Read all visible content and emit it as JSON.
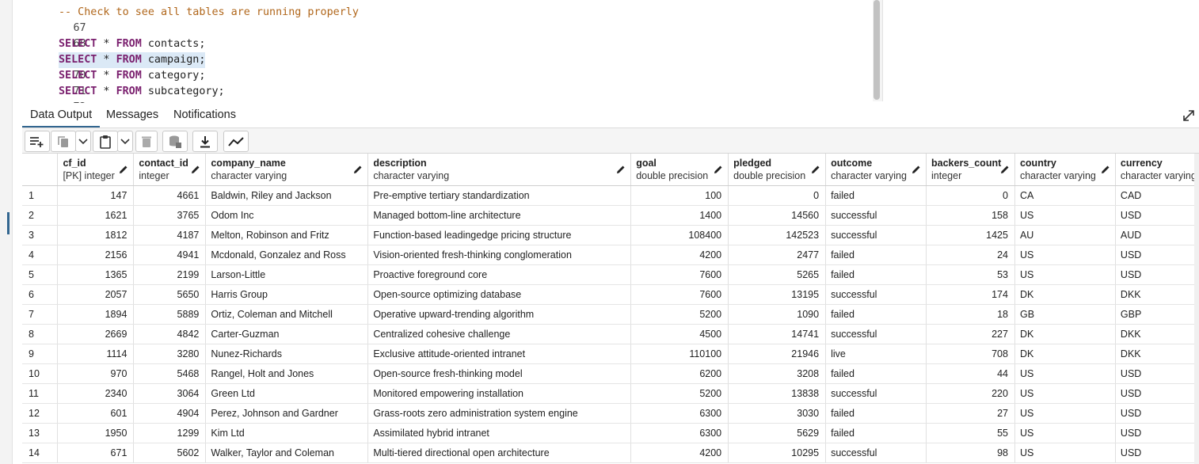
{
  "editor": {
    "lines": [
      {
        "num": "67",
        "comment": "-- Check to see all tables are running properly"
      },
      {
        "num": "68"
      },
      {
        "num": "69",
        "kw1": "SELECT",
        "op": " * ",
        "kw2": "FROM",
        "rest": " contacts;"
      },
      {
        "num": "70",
        "kw1": "SELECT",
        "op": " * ",
        "kw2": "FROM",
        "rest": " campaign;"
      },
      {
        "num": "71",
        "kw1": "SELECT",
        "op": " * ",
        "kw2": "FROM",
        "rest": " category;"
      },
      {
        "num": "72",
        "kw1": "SELECT",
        "op": " * ",
        "kw2": "FROM",
        "rest": " subcategory;"
      }
    ]
  },
  "tabs": {
    "data_output": "Data Output",
    "messages": "Messages",
    "notifications": "Notifications"
  },
  "toolbar": {
    "icons": [
      "add-row-icon",
      "copy-icon",
      "chevron-down-icon",
      "paste-icon",
      "chevron-down-icon",
      "delete-icon",
      "save-data-icon",
      "download-icon",
      "graph-icon"
    ]
  },
  "grid": {
    "columns": [
      {
        "name": "cf_id",
        "type": "[PK] integer"
      },
      {
        "name": "contact_id",
        "type": "integer"
      },
      {
        "name": "company_name",
        "type": "character varying"
      },
      {
        "name": "description",
        "type": "character varying"
      },
      {
        "name": "goal",
        "type": "double precision"
      },
      {
        "name": "pledged",
        "type": "double precision"
      },
      {
        "name": "outcome",
        "type": "character varying"
      },
      {
        "name": "backers_count",
        "type": "integer"
      },
      {
        "name": "country",
        "type": "character varying"
      },
      {
        "name": "currency",
        "type": "character varying"
      }
    ],
    "rows": [
      [
        "1",
        "147",
        "4661",
        "Baldwin, Riley and Jackson",
        "Pre-emptive tertiary standardization",
        "100",
        "0",
        "failed",
        "0",
        "CA",
        "CAD"
      ],
      [
        "2",
        "1621",
        "3765",
        "Odom Inc",
        "Managed bottom-line architecture",
        "1400",
        "14560",
        "successful",
        "158",
        "US",
        "USD"
      ],
      [
        "3",
        "1812",
        "4187",
        "Melton, Robinson and Fritz",
        "Function-based leadingedge pricing structure",
        "108400",
        "142523",
        "successful",
        "1425",
        "AU",
        "AUD"
      ],
      [
        "4",
        "2156",
        "4941",
        "Mcdonald, Gonzalez and Ross",
        "Vision-oriented fresh-thinking conglomeration",
        "4200",
        "2477",
        "failed",
        "24",
        "US",
        "USD"
      ],
      [
        "5",
        "1365",
        "2199",
        "Larson-Little",
        "Proactive foreground core",
        "7600",
        "5265",
        "failed",
        "53",
        "US",
        "USD"
      ],
      [
        "6",
        "2057",
        "5650",
        "Harris Group",
        "Open-source optimizing database",
        "7600",
        "13195",
        "successful",
        "174",
        "DK",
        "DKK"
      ],
      [
        "7",
        "1894",
        "5889",
        "Ortiz, Coleman and Mitchell",
        "Operative upward-trending algorithm",
        "5200",
        "1090",
        "failed",
        "18",
        "GB",
        "GBP"
      ],
      [
        "8",
        "2669",
        "4842",
        "Carter-Guzman",
        "Centralized cohesive challenge",
        "4500",
        "14741",
        "successful",
        "227",
        "DK",
        "DKK"
      ],
      [
        "9",
        "1114",
        "3280",
        "Nunez-Richards",
        "Exclusive attitude-oriented intranet",
        "110100",
        "21946",
        "live",
        "708",
        "DK",
        "DKK"
      ],
      [
        "10",
        "970",
        "5468",
        "Rangel, Holt and Jones",
        "Open-source fresh-thinking model",
        "6200",
        "3208",
        "failed",
        "44",
        "US",
        "USD"
      ],
      [
        "11",
        "2340",
        "3064",
        "Green Ltd",
        "Monitored empowering installation",
        "5200",
        "13838",
        "successful",
        "220",
        "US",
        "USD"
      ],
      [
        "12",
        "601",
        "4904",
        "Perez, Johnson and Gardner",
        "Grass-roots zero administration system engine",
        "6300",
        "3030",
        "failed",
        "27",
        "US",
        "USD"
      ],
      [
        "13",
        "1950",
        "1299",
        "Kim Ltd",
        "Assimilated hybrid intranet",
        "6300",
        "5629",
        "failed",
        "55",
        "US",
        "USD"
      ],
      [
        "14",
        "671",
        "5602",
        "Walker, Taylor and Coleman",
        "Multi-tiered directional open architecture",
        "4200",
        "10295",
        "successful",
        "98",
        "US",
        "USD"
      ]
    ]
  },
  "colors": {
    "keyword": "#7a1f6e",
    "comment": "#b0661a",
    "accent": "#326690",
    "selection": "#dbe9f6"
  }
}
